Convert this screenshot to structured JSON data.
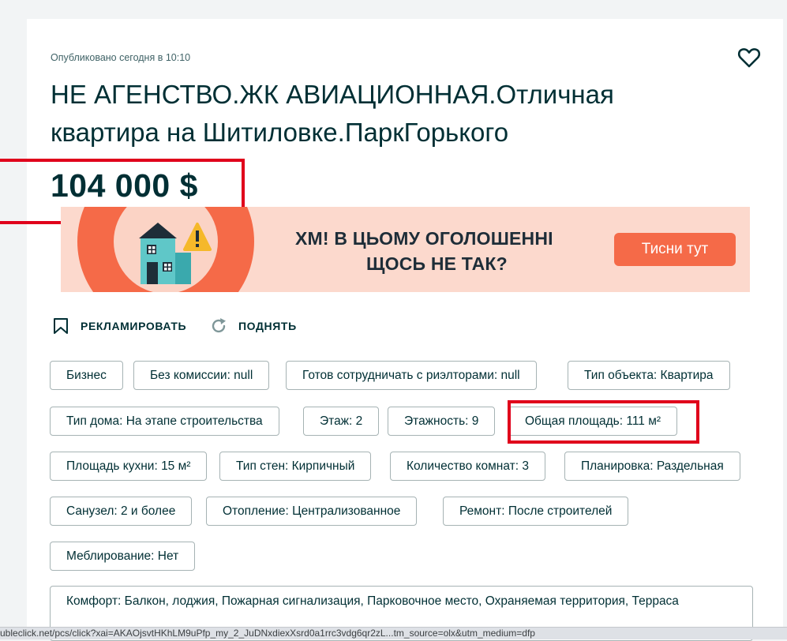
{
  "listing": {
    "published": "Опубликовано сегодня в 10:10",
    "title": "НЕ АГЕНСТВО.ЖК АВИАЦИОННАЯ.Отличная квартира на Шитиловке.ПаркГорького",
    "price": "104 000 $"
  },
  "banner": {
    "line1": "ХМ! В ЦЬОМУ ОГОЛОШЕННІ",
    "line2": "ЩОСЬ НЕ ТАК?",
    "cta": "Тисни тут",
    "colors": {
      "background": "#fcd9cd",
      "accent": "#f56a48"
    }
  },
  "actions": {
    "promote": "РЕКЛАМИРОВАТЬ",
    "raise": "ПОДНЯТЬ"
  },
  "params": [
    "Бизнес",
    "Без комиссии: null",
    "Готов сотрудничать с риэлторами: null",
    "Тип объекта: Квартира",
    "Тип дома: На этапе строительства",
    "Этаж: 2",
    "Этажность: 9",
    "Общая площадь: 111 м²",
    "Площадь кухни: 15 м²",
    "Тип стен: Кирпичный",
    "Количество комнат: 3",
    "Планировка: Раздельная",
    "Санузел: 2 и более",
    "Отопление: Централизованное",
    "Ремонт: После строителей",
    "Меблирование: Нет"
  ],
  "comfort": "Комфорт: Балкон, лоджия, Пожарная сигнализация, Парковочное место, Охраняемая территория, Терраса",
  "status_url": "ubleclick.net/pcs/click?xai=AKAOjsvtHKhLM9uPfp_my_2_JuDNxdiexXsrd0a1rrc3vdg6qr2zL...tm_source=olx&utm_medium=dfp",
  "highlight_color": "#e0001b"
}
